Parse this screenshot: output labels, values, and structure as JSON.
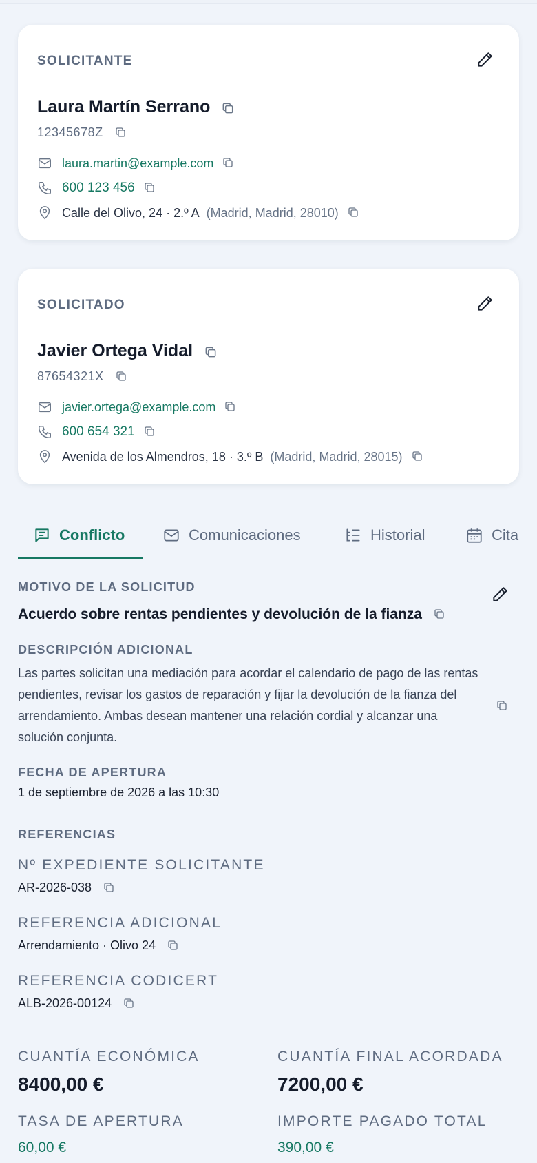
{
  "applicant": {
    "label": "SOLICITANTE",
    "name": "Laura Martín Serrano",
    "id_number": "12345678Z",
    "email": "laura.martin@example.com",
    "phone": "600 123 456",
    "address": "Calle del Olivo, 24 · 2.º A",
    "address_extra": "(Madrid, Madrid, 28010)"
  },
  "respondent": {
    "label": "SOLICITADO",
    "name": "Javier Ortega Vidal",
    "id_number": "87654321X",
    "email": "javier.ortega@example.com",
    "phone": "600 654 321",
    "address": "Avenida de los Almendros, 18 · 3.º B",
    "address_extra": "(Madrid, Madrid, 28015)"
  },
  "tabs": [
    {
      "label": "Conflicto",
      "icon": "message-square-icon",
      "active": true
    },
    {
      "label": "Comunicaciones",
      "icon": "mail-icon",
      "active": false
    },
    {
      "label": "Historial",
      "icon": "list-tree-icon",
      "active": false
    },
    {
      "label": "Cita",
      "icon": "calendar-icon",
      "active": false
    }
  ],
  "conflict": {
    "reason_label": "MOTIVO DE LA SOLICITUD",
    "reason": "Acuerdo sobre rentas pendientes y devolución de la fianza",
    "description_label": "DESCRIPCIÓN ADICIONAL",
    "description": "Las partes solicitan una mediación para acordar el calendario de pago de las rentas pendientes, revisar los gastos de reparación y fijar la devolución de la fianza del arrendamiento. Ambas desean mantener una relación cordial y alcanzar una solución conjunta.",
    "opening_date_label": "FECHA DE APERTURA",
    "opening_date": "1 de septiembre de 2026 a las 10:30",
    "references_label": "REFERENCIAS",
    "file_number_label": "Nº EXPEDIENTE SOLICITANTE",
    "file_number": "AR-2026-038",
    "additional_ref_label": "REFERENCIA ADICIONAL",
    "additional_ref": "Arrendamiento · Olivo 24",
    "codicert_label": "REFERENCIA CODICERT",
    "codicert": "ALB-2026-00124"
  },
  "amounts": {
    "economic_label": "CUANTÍA ECONÓMICA",
    "economic": "8400,00 €",
    "final_label": "CUANTÍA FINAL ACORDADA",
    "final": "7200,00 €",
    "opening_fee_label": "TASA DE APERTURA",
    "opening_fee": "60,00 €",
    "total_paid_label": "IMPORTE PAGADO TOTAL",
    "total_paid": "390,00 €"
  },
  "colors": {
    "accent": "#167862",
    "background": "#f0f4fa",
    "muted": "#5e6b80"
  }
}
